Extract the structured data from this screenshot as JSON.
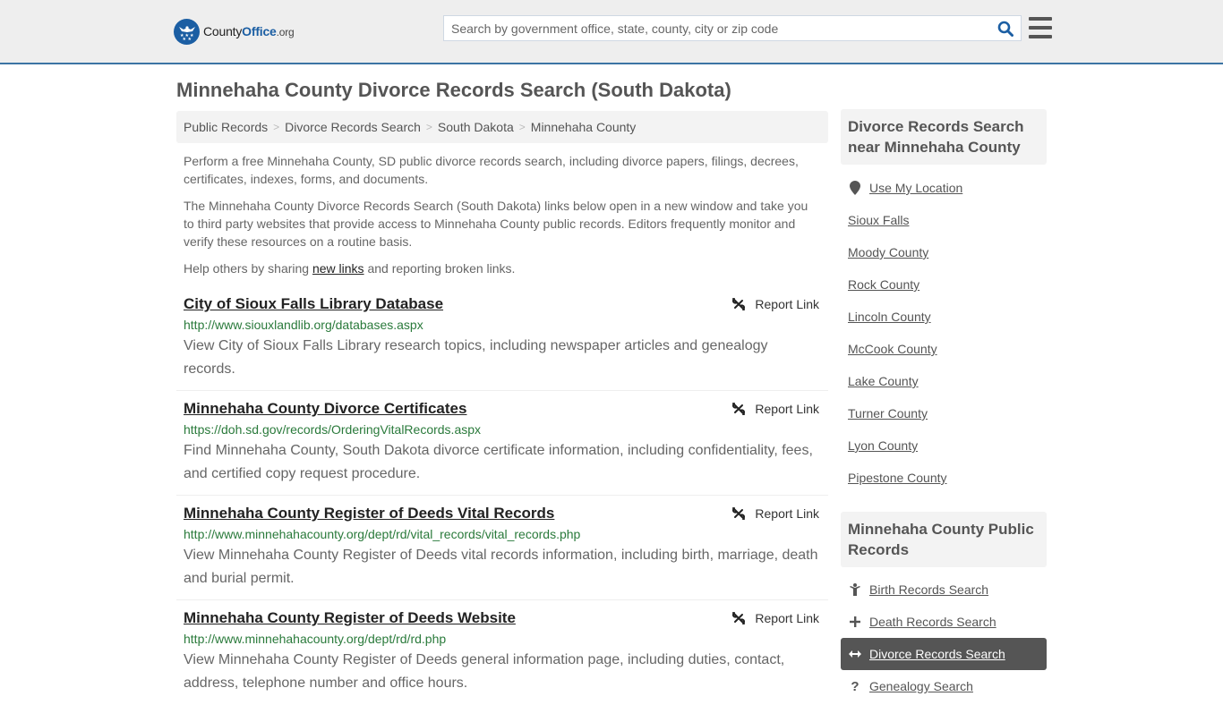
{
  "header": {
    "logo": {
      "county": "County",
      "office": "Office",
      "org": ".org"
    },
    "search_placeholder": "Search by government office, state, county, city or zip code",
    "search_value": "",
    "icons": {
      "search": "search-icon",
      "menu": "hamburger-menu-icon",
      "logo": "eagle-stars-logo-icon"
    }
  },
  "page_title": "Minnehaha County Divorce Records Search (South Dakota)",
  "breadcrumb": [
    "Public Records",
    "Divorce Records Search",
    "South Dakota",
    "Minnehaha County"
  ],
  "intro": {
    "p1": "Perform a free Minnehaha County, SD public divorce records search, including divorce papers, filings, decrees, certificates, indexes, forms, and documents.",
    "p2": "The Minnehaha County Divorce Records Search (South Dakota) links below open in a new window and take you to third party websites that provide access to Minnehaha County public records. Editors frequently monitor and verify these resources on a routine basis.",
    "p3_before": "Help others by sharing ",
    "p3_link": "new links",
    "p3_after": " and reporting broken links."
  },
  "report_label": "Report Link",
  "results": [
    {
      "title": "City of Sioux Falls Library Database",
      "url": "http://www.siouxlandlib.org/databases.aspx",
      "description": "View City of Sioux Falls Library research topics, including newspaper articles and genealogy records."
    },
    {
      "title": "Minnehaha County Divorce Certificates",
      "url": "https://doh.sd.gov/records/OrderingVitalRecords.aspx",
      "description": "Find Minnehaha County, South Dakota divorce certificate information, including confidentiality, fees, and certified copy request procedure."
    },
    {
      "title": "Minnehaha County Register of Deeds Vital Records",
      "url": "http://www.minnehahacounty.org/dept/rd/vital_records/vital_records.php",
      "description": "View Minnehaha County Register of Deeds vital records information, including birth, marriage, death and burial permit."
    },
    {
      "title": "Minnehaha County Register of Deeds Website",
      "url": "http://www.minnehahacounty.org/dept/rd/rd.php",
      "description": "View Minnehaha County Register of Deeds general information page, including duties, contact, address, telephone number and office hours."
    }
  ],
  "sidebar": {
    "nearby_heading": "Divorce Records Search near Minnehaha County",
    "use_location": "Use My Location",
    "nearby": [
      "Sioux Falls",
      "Moody County",
      "Rock County",
      "Lincoln County",
      "McCook County",
      "Lake County",
      "Turner County",
      "Lyon County",
      "Pipestone County"
    ],
    "public_heading": "Minnehaha County Public Records",
    "public_records": [
      {
        "label": "Birth Records Search",
        "icon": "person-icon",
        "active": false
      },
      {
        "label": "Death Records Search",
        "icon": "plus-cross-icon",
        "active": false
      },
      {
        "label": "Divorce Records Search",
        "icon": "left-right-arrow-icon",
        "active": true
      },
      {
        "label": "Genealogy Search",
        "icon": "question-icon",
        "active": false
      }
    ]
  },
  "colors": {
    "brand_blue": "#1b5ea3",
    "header_border": "#3c74a4",
    "url_green": "#2a7a3b",
    "active_bg": "#555555"
  }
}
